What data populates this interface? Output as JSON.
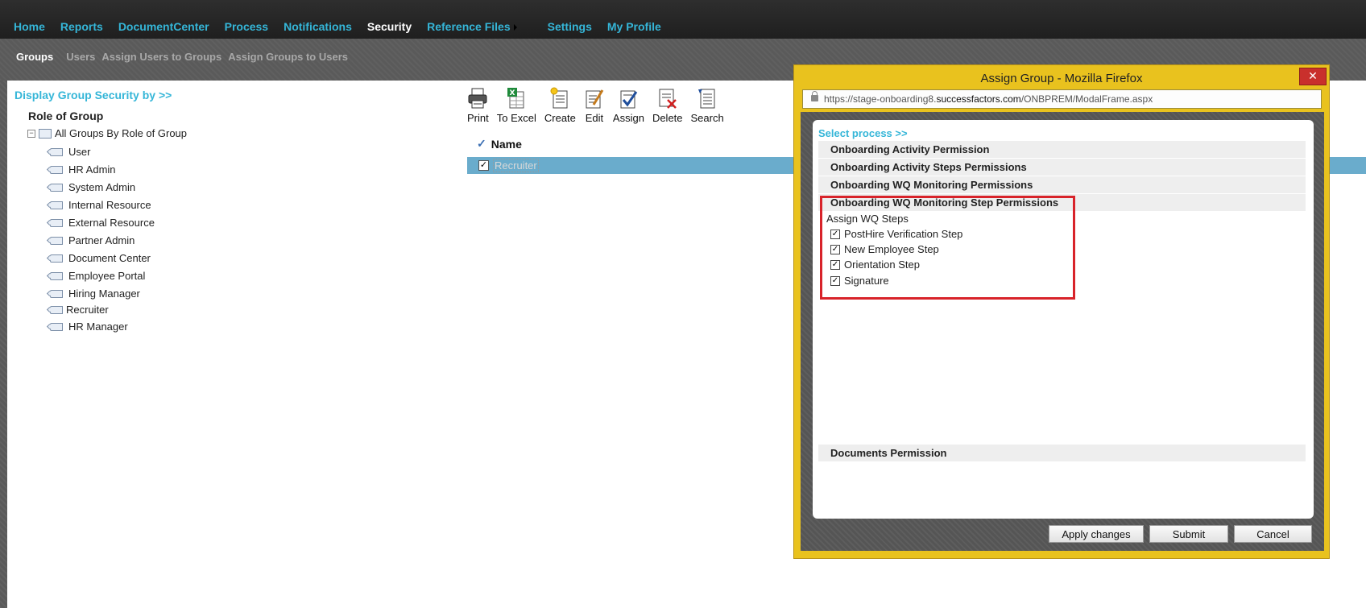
{
  "top_nav": [
    {
      "label": "Home",
      "active": false
    },
    {
      "label": "Reports",
      "active": false
    },
    {
      "label": "DocumentCenter",
      "active": false
    },
    {
      "label": "Process",
      "active": false
    },
    {
      "label": "Notifications",
      "active": false
    },
    {
      "label": "Security",
      "active": true
    },
    {
      "label": "Reference Files",
      "active": false
    },
    {
      "label": "Settings",
      "active": false
    },
    {
      "label": "My Profile",
      "active": false
    }
  ],
  "sub_nav": [
    {
      "label": "Groups",
      "active": true
    },
    {
      "label": "Users",
      "active": false
    },
    {
      "label": "Assign Users to Groups",
      "active": false
    },
    {
      "label": "Assign Groups to Users",
      "active": false
    }
  ],
  "left": {
    "display_link": "Display Group Security by >>",
    "tree_title": "Role of Group",
    "root": "All Groups By Role of Group",
    "items": [
      "User",
      "HR Admin",
      "System Admin",
      "Internal Resource",
      "External Resource",
      "Partner Admin",
      "Document Center",
      "Employee Portal",
      "Hiring Manager",
      "Recruiter",
      "HR Manager"
    ]
  },
  "toolbar": {
    "print": "Print",
    "to_excel": "To Excel",
    "create": "Create",
    "edit": "Edit",
    "assign": "Assign",
    "delete": "Delete",
    "search": "Search"
  },
  "list": {
    "header": "Name",
    "rows": [
      {
        "name": "Recruiter",
        "checked": true
      }
    ]
  },
  "modal": {
    "title": "Assign Group - Mozilla Firefox",
    "close": "✕",
    "url_prefix": "https://stage-onboarding8.",
    "url_domain": "successfactors.com",
    "url_path": "/ONBPREM/ModalFrame.aspx",
    "select_process": "Select process >>",
    "sections": {
      "activity": "Onboarding Activity Permission",
      "activity_steps": "Onboarding Activity Steps Permissions",
      "wq_monitoring": "Onboarding WQ Monitoring Permissions",
      "wq_step": "Onboarding WQ Monitoring Step Permissions",
      "documents": "Documents Permission"
    },
    "assign_title": "Assign WQ Steps",
    "steps": [
      {
        "label": "PostHire Verification Step",
        "checked": true
      },
      {
        "label": "New Employee Step",
        "checked": true
      },
      {
        "label": "Orientation Step",
        "checked": true
      },
      {
        "label": "Signature",
        "checked": true
      }
    ],
    "buttons": {
      "apply": "Apply changes",
      "submit": "Submit",
      "cancel": "Cancel"
    }
  },
  "colors": {
    "accent": "#35b6d8",
    "modal_frame": "#e9c21e",
    "highlight": "#d8232a",
    "selected_row": "#6aaccc"
  }
}
